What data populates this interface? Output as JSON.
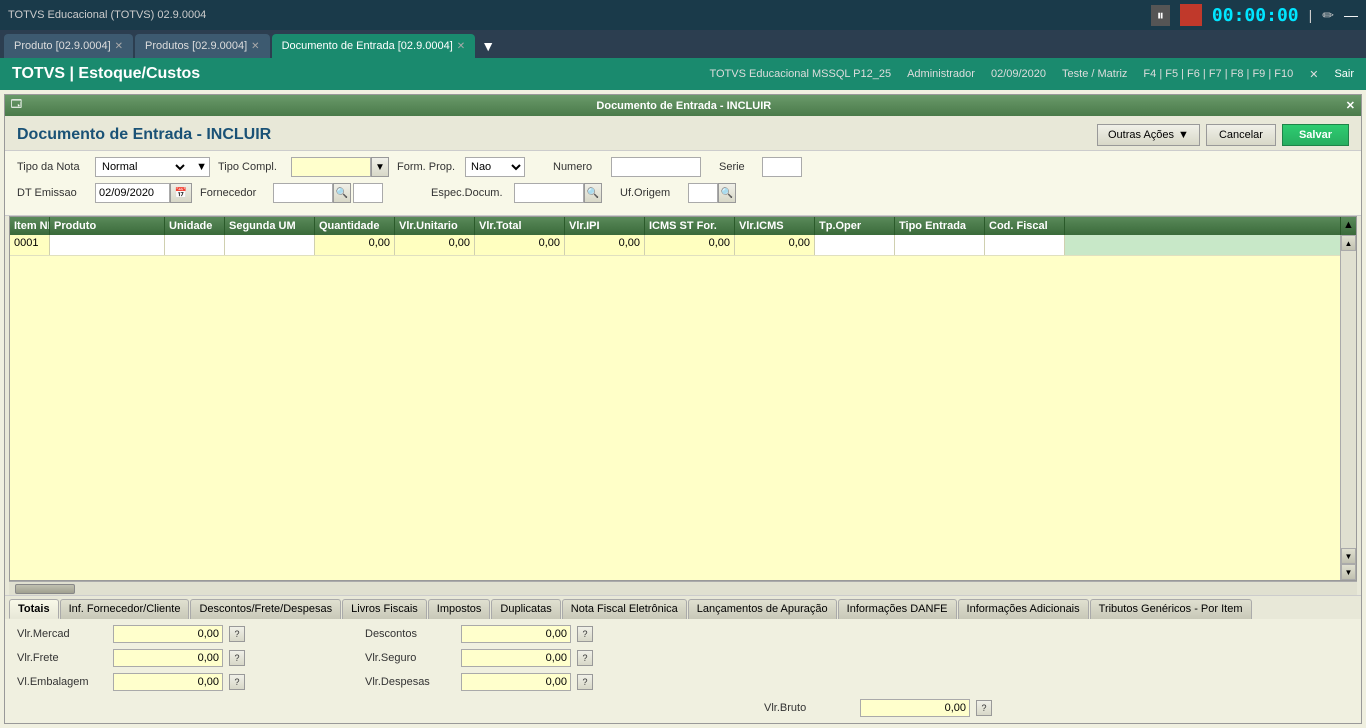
{
  "appTitle": "TOTVS Educacional (TOTVS) 02.9.0004",
  "timer": "00:00:00",
  "tabs": [
    {
      "label": "Produto [02.9.0004]",
      "active": false
    },
    {
      "label": "Produtos [02.9.0004]",
      "active": false
    },
    {
      "label": "Documento de Entrada [02.9.0004]",
      "active": true
    }
  ],
  "headerTitle": "TOTVS | Estoque/Custos",
  "headerInfo": {
    "system": "TOTVS Educacional MSSQL P12_25",
    "user": "Administrador",
    "date": "02/09/2020",
    "branch": "Teste / Matriz",
    "shortcuts": "F4 | F5 | F6 | F7 | F8 | F9 | F10",
    "exit": "Sair"
  },
  "windowTitle": "Documento de Entrada - INCLUIR",
  "formTitle": "Documento de Entrada - INCLUIR",
  "buttons": {
    "outrasAcoes": "Outras Ações",
    "cancelar": "Cancelar",
    "salvar": "Salvar"
  },
  "form": {
    "tipoNotaLabel": "Tipo da Nota",
    "tipoNotaValue": "Normal",
    "tipoComplLabel": "Tipo Compl.",
    "tipoComplValue": "",
    "formPropLabel": "Form. Prop.",
    "formPropValue": "Nao",
    "numeroLabel": "Numero",
    "numeroValue": "",
    "serieLabel": "Serie",
    "serieValue": "",
    "dtEmissaoLabel": "DT Emissao",
    "dtEmissaoValue": "02/09/2020",
    "fornecedorLabel": "Fornecedor",
    "fornecedorValue": "",
    "especDocumLabel": "Espec.Docum.",
    "especDocumValue": "",
    "ufOrigemLabel": "Uf.Origem",
    "ufOrigemValue": ""
  },
  "grid": {
    "columns": [
      "Item NF",
      "Produto",
      "Unidade",
      "Segunda UM",
      "Quantidade",
      "Vlr.Unitario",
      "Vlr.Total",
      "Vlr.IPI",
      "ICMS ST For.",
      "Vlr.ICMS",
      "Tp.Oper",
      "Tipo Entrada",
      "Cod. Fiscal"
    ],
    "rows": [
      {
        "item": "0001",
        "produto": "",
        "unidade": "",
        "segunda": "",
        "quantidade": "0,00",
        "vlrUnit": "0,00",
        "vlrTotal": "0,00",
        "vlrIPI": "0,00",
        "icmsST": "0,00",
        "vlrICMS": "0,00",
        "tpOper": "",
        "tipoEnt": "",
        "codFisc": ""
      }
    ]
  },
  "bottomTabs": [
    "Totais",
    "Inf. Fornecedor/Cliente",
    "Descontos/Frete/Despesas",
    "Livros Fiscais",
    "Impostos",
    "Duplicatas",
    "Nota Fiscal Eletrônica",
    "Lançamentos de Apuração",
    "Informações DANFE",
    "Informações Adicionais",
    "Tributos Genéricos - Por Item"
  ],
  "totals": {
    "left": [
      {
        "label": "Vlr.Mercad",
        "value": "0,00"
      },
      {
        "label": "Vlr.Frete",
        "value": "0,00"
      },
      {
        "label": "Vl.Embalagem",
        "value": "0,00"
      }
    ],
    "right": [
      {
        "label": "Descontos",
        "value": "0,00"
      },
      {
        "label": "Vlr.Seguro",
        "value": "0,00"
      },
      {
        "label": "Vlr.Despesas",
        "value": "0,00"
      }
    ],
    "bottom": [
      {
        "label": "Vlr.Bruto",
        "value": "0,00"
      }
    ]
  }
}
